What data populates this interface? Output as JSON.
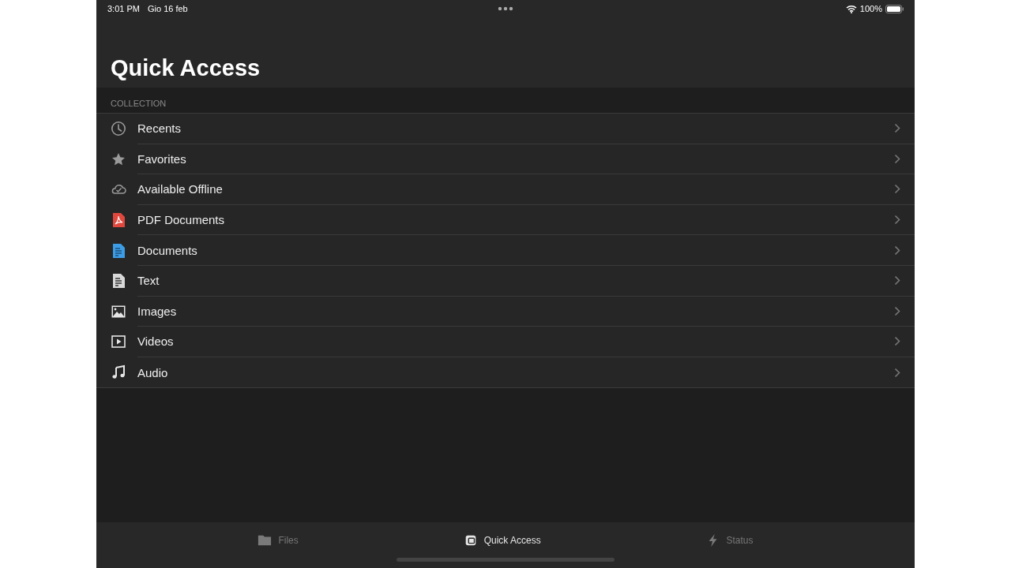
{
  "status_bar": {
    "time": "3:01 PM",
    "date": "Gio 16 feb",
    "battery": "100%"
  },
  "title": "Quick Access",
  "section": {
    "header": "COLLECTION",
    "items": [
      {
        "label": "Recents",
        "kind": "clock"
      },
      {
        "label": "Favorites",
        "kind": "star"
      },
      {
        "label": "Available Offline",
        "kind": "cloud"
      },
      {
        "label": "PDF Documents",
        "kind": "pdf"
      },
      {
        "label": "Documents",
        "kind": "doc"
      },
      {
        "label": "Text",
        "kind": "text"
      },
      {
        "label": "Images",
        "kind": "image"
      },
      {
        "label": "Videos",
        "kind": "video"
      },
      {
        "label": "Audio",
        "kind": "audio"
      }
    ]
  },
  "tab_bar": [
    {
      "label": "Files",
      "kind": "folder",
      "selected": false
    },
    {
      "label": "Quick Access",
      "kind": "quick",
      "selected": true
    },
    {
      "label": "Status",
      "kind": "bolt",
      "selected": false
    }
  ]
}
